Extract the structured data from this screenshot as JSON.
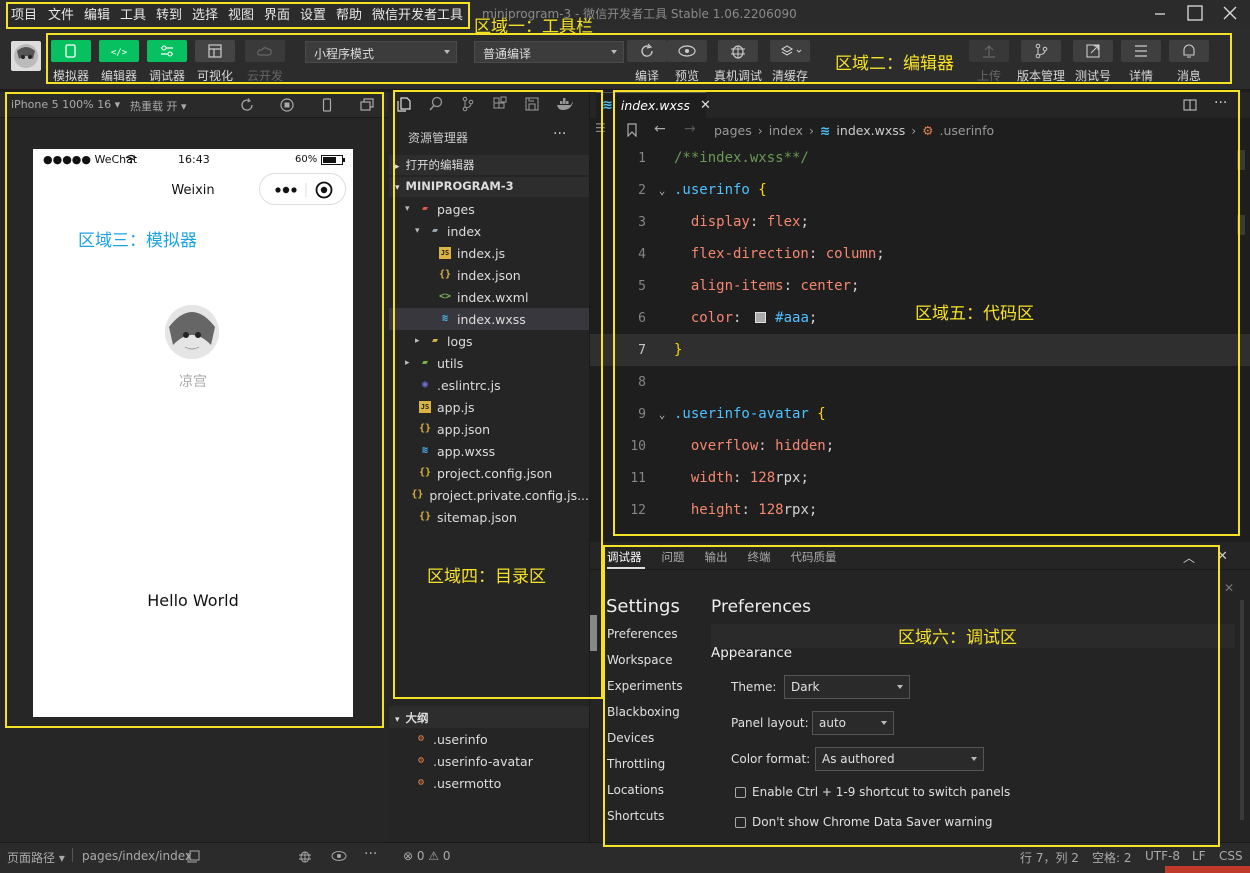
{
  "menu": [
    "项目",
    "文件",
    "编辑",
    "工具",
    "转到",
    "选择",
    "视图",
    "界面",
    "设置",
    "帮助",
    "微信开发者工具"
  ],
  "window_title": "miniprogram-3 - 微信开发者工具 Stable 1.06.2206090",
  "toolbar": {
    "left_buttons": [
      "模拟器",
      "编辑器",
      "调试器",
      "可视化",
      "云开发"
    ],
    "mode_select": "小程序模式",
    "compile_select": "普通编译",
    "mid_buttons": [
      "编译",
      "预览",
      "真机调试",
      "清缓存"
    ],
    "right_buttons": [
      "上传",
      "版本管理",
      "测试号",
      "详情",
      "消息"
    ]
  },
  "annotations": {
    "region1": "区域一：工具栏",
    "region2": "区域二：编辑器",
    "region3": "区域三：模拟器",
    "region4": "区域四：目录区",
    "region5": "区域五：代码区",
    "region6": "区域六：调试区"
  },
  "simulator": {
    "device": "iPhone 5 100% 16",
    "hot_reload": "热重载 开",
    "carrier": "●●●●● WeChat",
    "time": "16:43",
    "battery": "60%",
    "nav_title": "Weixin",
    "nickname": "凉宫",
    "motto": "Hello World"
  },
  "explorer": {
    "title": "资源管理器",
    "open_editors": "打开的编辑器",
    "project": "MINIPROGRAM-3",
    "files": [
      {
        "name": "pages",
        "type": "folder-red",
        "depth": 1,
        "arrow": "▾"
      },
      {
        "name": "index",
        "type": "folder",
        "depth": 2,
        "arrow": "▾"
      },
      {
        "name": "index.js",
        "type": "js",
        "depth": 3,
        "arrow": ""
      },
      {
        "name": "index.json",
        "type": "json",
        "depth": 3,
        "arrow": ""
      },
      {
        "name": "index.wxml",
        "type": "wxml",
        "depth": 3,
        "arrow": ""
      },
      {
        "name": "index.wxss",
        "type": "wxss",
        "depth": 3,
        "arrow": ""
      },
      {
        "name": "logs",
        "type": "folder-yellow",
        "depth": 2,
        "arrow": "▸"
      },
      {
        "name": "utils",
        "type": "folder-green",
        "depth": 1,
        "arrow": "▸"
      },
      {
        "name": ".eslintrc.js",
        "type": "eslint",
        "depth": 1,
        "arrow": ""
      },
      {
        "name": "app.js",
        "type": "js",
        "depth": 1,
        "arrow": ""
      },
      {
        "name": "app.json",
        "type": "json",
        "depth": 1,
        "arrow": ""
      },
      {
        "name": "app.wxss",
        "type": "wxss",
        "depth": 1,
        "arrow": ""
      },
      {
        "name": "project.config.json",
        "type": "json",
        "depth": 1,
        "arrow": ""
      },
      {
        "name": "project.private.config.js...",
        "type": "json",
        "depth": 1,
        "arrow": ""
      },
      {
        "name": "sitemap.json",
        "type": "json",
        "depth": 1,
        "arrow": ""
      }
    ],
    "outline_title": "大纲",
    "outline": [
      ".userinfo",
      ".userinfo-avatar",
      ".usermotto"
    ]
  },
  "editor": {
    "tab": "index.wxss",
    "breadcrumb": [
      "pages",
      "index",
      "index.wxss",
      ".userinfo"
    ],
    "lines": [
      {
        "n": "1",
        "t": [
          [
            "/**index.wxss**/",
            "#6a9955"
          ]
        ]
      },
      {
        "n": "2",
        "fold": true,
        "t": [
          [
            ".userinfo",
            "#4fc1ff"
          ],
          [
            " {",
            "#ffd700"
          ]
        ]
      },
      {
        "n": "3",
        "t": [
          [
            "  display",
            "#f48771"
          ],
          [
            ": ",
            "#d4d4d4"
          ],
          [
            "flex",
            "#f48771"
          ],
          [
            ";",
            "#d4d4d4"
          ]
        ]
      },
      {
        "n": "4",
        "t": [
          [
            "  flex-direction",
            "#f48771"
          ],
          [
            ": ",
            "#d4d4d4"
          ],
          [
            "column",
            "#f48771"
          ],
          [
            ";",
            "#d4d4d4"
          ]
        ]
      },
      {
        "n": "5",
        "t": [
          [
            "  align-items",
            "#f48771"
          ],
          [
            ": ",
            "#d4d4d4"
          ],
          [
            "center",
            "#f48771"
          ],
          [
            ";",
            "#d4d4d4"
          ]
        ]
      },
      {
        "n": "6",
        "swatch": "#aaa",
        "t": [
          [
            "  color",
            "#f48771"
          ],
          [
            ": ",
            "#d4d4d4"
          ],
          [
            "   #aaa",
            "#4fc1ff"
          ],
          [
            ";",
            "#d4d4d4"
          ]
        ]
      },
      {
        "n": "7",
        "active": true,
        "t": [
          [
            "}",
            "#ffd700"
          ]
        ]
      },
      {
        "n": "8",
        "t": []
      },
      {
        "n": "9",
        "fold": true,
        "t": [
          [
            ".userinfo-avatar",
            "#4fc1ff"
          ],
          [
            " {",
            "#ffd700"
          ]
        ]
      },
      {
        "n": "10",
        "t": [
          [
            "  overflow",
            "#f48771"
          ],
          [
            ": ",
            "#d4d4d4"
          ],
          [
            "hidden",
            "#f48771"
          ],
          [
            ";",
            "#d4d4d4"
          ]
        ]
      },
      {
        "n": "11",
        "t": [
          [
            "  width",
            "#f48771"
          ],
          [
            ": ",
            "#d4d4d4"
          ],
          [
            "128",
            "#f48771"
          ],
          [
            "rpx;",
            "#d4d4d4"
          ]
        ]
      },
      {
        "n": "12",
        "t": [
          [
            "  height",
            "#f48771"
          ],
          [
            ": ",
            "#d4d4d4"
          ],
          [
            "128",
            "#f48771"
          ],
          [
            "rpx;",
            "#d4d4d4"
          ]
        ]
      }
    ]
  },
  "debug": {
    "tabs": [
      "调试器",
      "问题",
      "输出",
      "终端",
      "代码质量"
    ],
    "settings_title": "Settings",
    "nav": [
      "Preferences",
      "Workspace",
      "Experiments",
      "Blackboxing",
      "Devices",
      "Throttling",
      "Locations",
      "Shortcuts"
    ],
    "pref_title": "Preferences",
    "appearance": "Appearance",
    "theme_label": "Theme:",
    "theme_value": "Dark",
    "layout_label": "Panel layout:",
    "layout_value": "auto",
    "colorfmt_label": "Color format:",
    "colorfmt_value": "As authored",
    "check1": "Enable Ctrl + 1-9 shortcut to switch panels",
    "check2": "Don't show Chrome Data Saver warning"
  },
  "status": {
    "page_path_label": "页面路径",
    "page_path": "pages/index/index",
    "problems": "⊗ 0 ⚠ 0",
    "cursor": "行 7，列 2",
    "spaces": "空格: 2",
    "encoding": "UTF-8",
    "eol": "LF",
    "lang": "CSS"
  },
  "colors": {
    "accent_green": "#07c160",
    "annotation_yellow": "#f5e227",
    "annotation_blue": "#1aa3e6"
  }
}
